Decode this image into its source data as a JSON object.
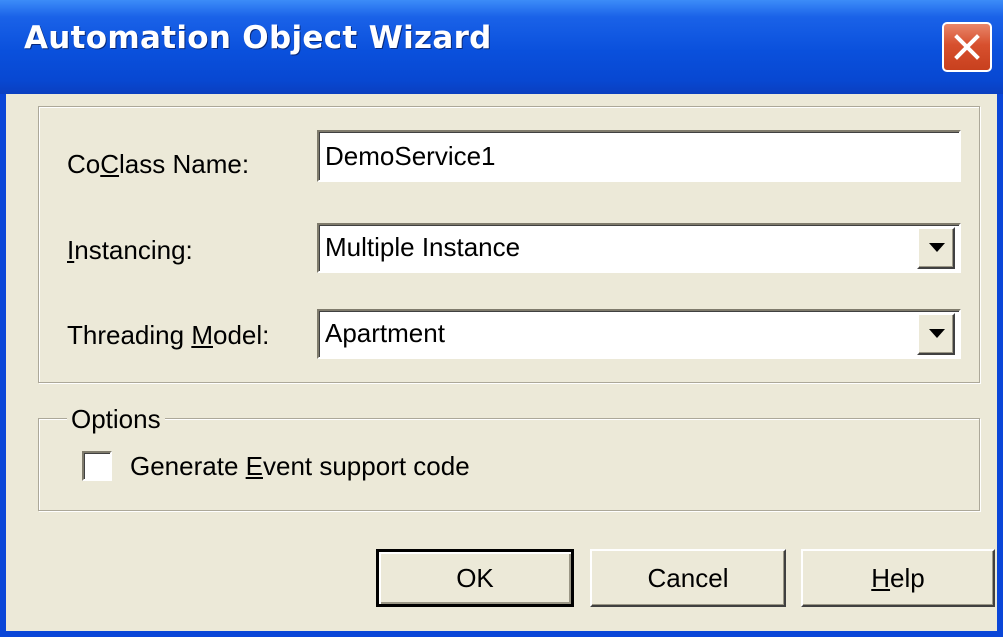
{
  "window": {
    "title": "Automation Object Wizard"
  },
  "form": {
    "coclass": {
      "label_pre": "Co",
      "label_mnemonic": "C",
      "label_post": "lass Name:",
      "value": "DemoService1"
    },
    "instancing": {
      "label_pre": "",
      "label_mnemonic": "I",
      "label_post": "nstancing:",
      "value": "Multiple Instance"
    },
    "threading": {
      "label_pre": "Threading ",
      "label_mnemonic": "M",
      "label_post": "odel:",
      "value": "Apartment"
    }
  },
  "options": {
    "legend": "Options",
    "event_support": {
      "label_pre": "Generate ",
      "label_mnemonic": "E",
      "label_post": "vent support code",
      "checked": false
    }
  },
  "buttons": {
    "ok": "OK",
    "cancel": "Cancel",
    "help_mnemonic": "H",
    "help_rest": "elp"
  },
  "icons": {
    "close": "close-icon",
    "dropdown": "chevron-down-icon"
  }
}
